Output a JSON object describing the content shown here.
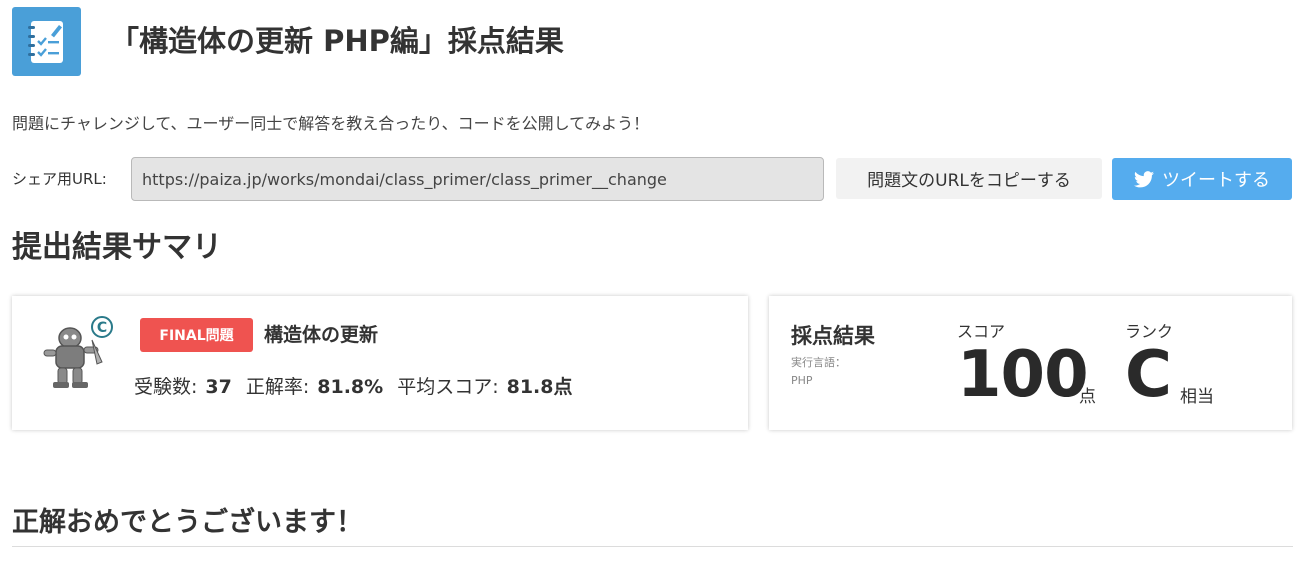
{
  "header": {
    "title": "「構造体の更新 PHP編」採点結果",
    "icon": "checklist-notebook-icon"
  },
  "description": "問題にチャレンジして、ユーザー同士で解答を教え合ったり、コードを公開してみよう！",
  "share": {
    "label": "シェア用URL:",
    "url": "https://paiza.jp/works/mondai/class_primer/class_primer__change",
    "copy_button": "問題文のURLをコピーする",
    "tweet_button": "ツイートする"
  },
  "summary": {
    "title": "提出結果サマリ",
    "problem": {
      "badge": "FINAL問題",
      "name": "構造体の更新",
      "mascot": "robot-mascot-icon",
      "mascot_letter": "C",
      "examinees_label": "受験数:",
      "examinees": "37",
      "accuracy_label": "正解率:",
      "accuracy": "81.8%",
      "average_label": "平均スコア:",
      "average": "81.8点"
    },
    "result": {
      "heading": "採点結果",
      "language_label": "実行言語：",
      "language": "PHP",
      "score_label": "スコア",
      "score": "100",
      "score_unit": "点",
      "rank_label": "ランク",
      "rank": "C",
      "rank_suffix": "相当"
    }
  },
  "congrats": "正解おめでとうございます！",
  "colors": {
    "accent_blue": "#4a9fd8",
    "twitter_blue": "#55acee",
    "final_badge_red": "#ef5350",
    "text": "#333333"
  }
}
